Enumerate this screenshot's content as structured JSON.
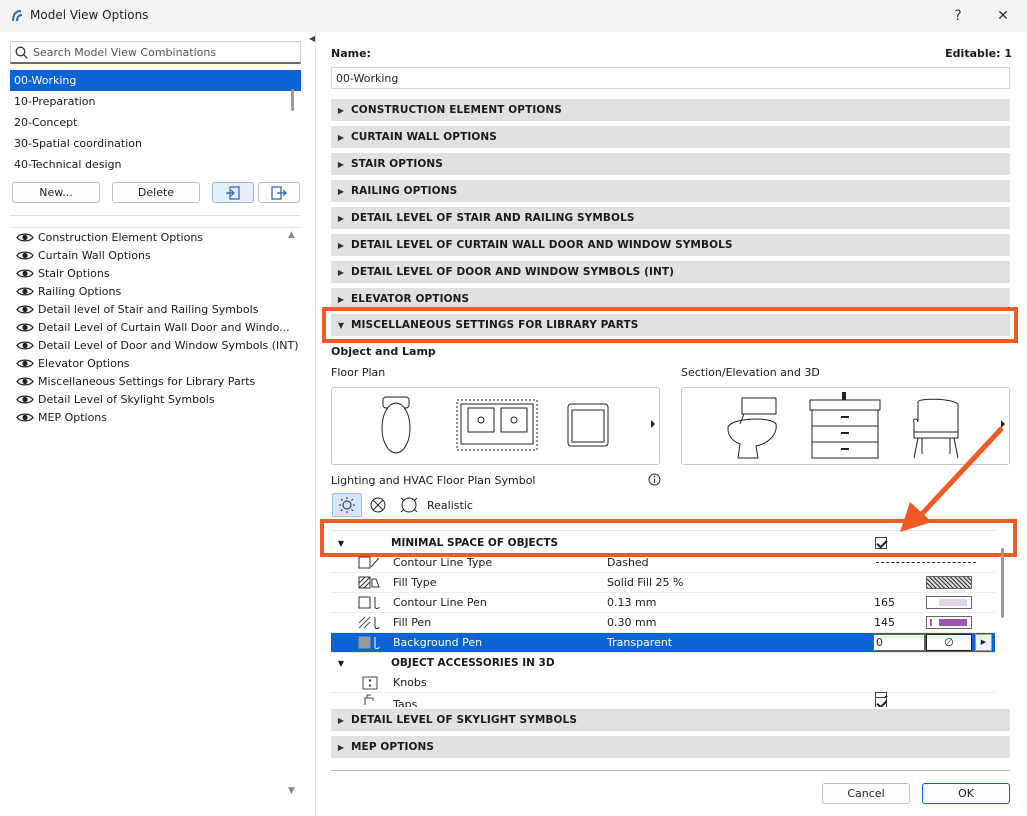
{
  "window": {
    "title": "Model View Options",
    "help_label": "?",
    "close_label": "✕"
  },
  "left": {
    "search_placeholder": "Search Model View Combinations",
    "combinations": [
      {
        "label": "00-Working",
        "selected": true
      },
      {
        "label": "10-Preparation"
      },
      {
        "label": "20-Concept"
      },
      {
        "label": "30-Spatial coordination"
      },
      {
        "label": "40-Technical design"
      }
    ],
    "new_label": "New...",
    "delete_label": "Delete",
    "tree": [
      "Construction Element Options",
      "Curtain Wall Options",
      "Stair Options",
      "Railing Options",
      "Detail level of Stair and Railing Symbols",
      "Detail Level of Curtain Wall Door and Windo...",
      "Detail Level of Door and Window Symbols (INT)",
      "Elevator Options",
      "Miscellaneous Settings for Library Parts",
      "Detail Level of Skylight Symbols",
      "MEP Options"
    ]
  },
  "right": {
    "name_label": "Name:",
    "editable_label": "Editable: 1",
    "name_value": "00-Working",
    "sections": [
      "CONSTRUCTION ELEMENT OPTIONS",
      "CURTAIN WALL OPTIONS",
      "STAIR OPTIONS",
      "RAILING OPTIONS",
      "DETAIL LEVEL OF STAIR AND RAILING SYMBOLS",
      "DETAIL LEVEL OF CURTAIN WALL DOOR AND WINDOW SYMBOLS",
      "DETAIL LEVEL OF DOOR AND WINDOW SYMBOLS (INT)",
      "ELEVATOR OPTIONS"
    ],
    "misc_section": "MISCELLANEOUS SETTINGS FOR LIBRARY PARTS",
    "object_lamp": "Object and Lamp",
    "floor_plan": "Floor Plan",
    "section_elev": "Section/Elevation and 3D",
    "lighting_label": "Lighting and HVAC Floor Plan Symbol",
    "realistic_label": "Realistic",
    "min_space": "MINIMAL SPACE OF OBJECTS",
    "rows": [
      {
        "name": "Contour Line Type",
        "value": "Dashed",
        "num": ""
      },
      {
        "name": "Fill Type",
        "value": "Solid Fill 25 %",
        "num": ""
      },
      {
        "name": "Contour Line Pen",
        "value": "0.13 mm",
        "num": "165"
      },
      {
        "name": "Fill Pen",
        "value": "0.30 mm",
        "num": "145"
      },
      {
        "name": "Background Pen",
        "value": "Transparent",
        "num": "0"
      }
    ],
    "accessories": "OBJECT ACCESSORIES IN 3D",
    "knobs": "Knobs",
    "taps": "Taps",
    "skylight_section": "DETAIL LEVEL OF SKYLIGHT SYMBOLS",
    "mep_section": "MEP OPTIONS",
    "cancel_label": "Cancel",
    "ok_label": "OK"
  },
  "colors": {
    "highlight": "#f15a22",
    "selection": "#0a64d4"
  }
}
